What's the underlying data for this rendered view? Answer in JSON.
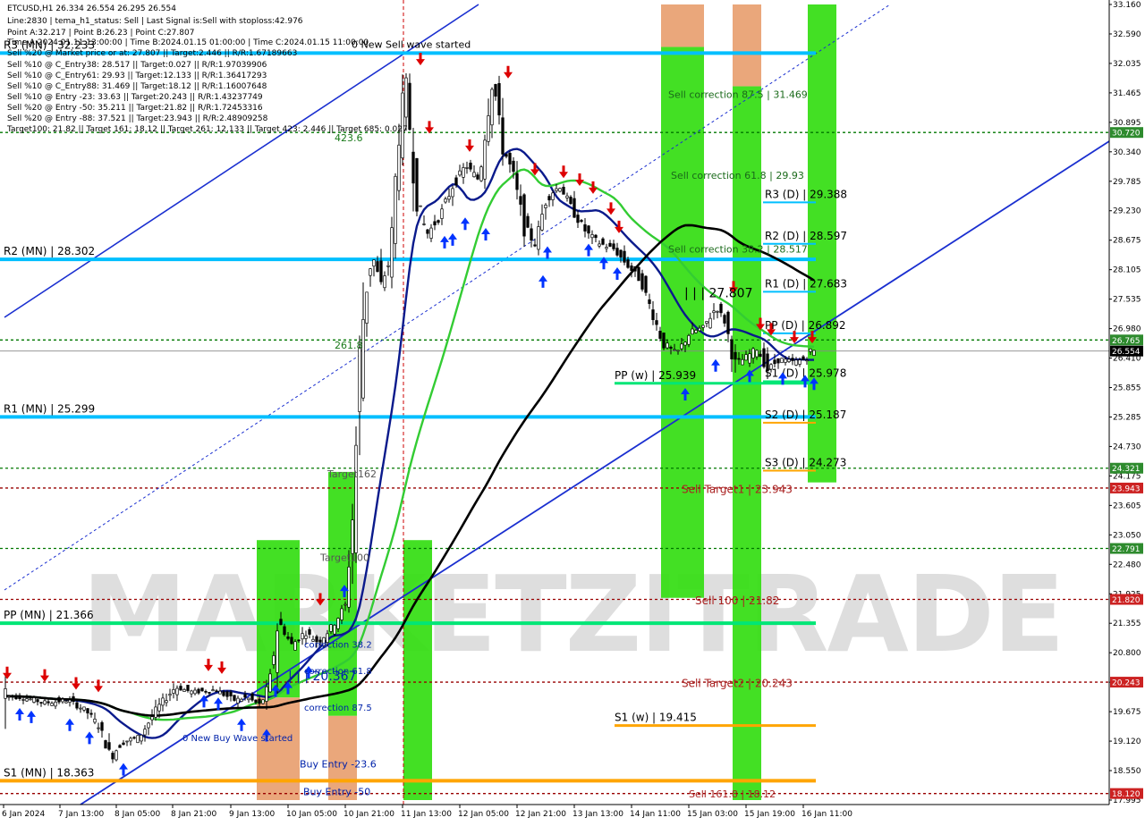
{
  "header": {
    "symbol_line": "ETCUSD,H1  26.334 26.554 26.295 26.554",
    "info_lines": [
      "Line:2830 | tema_h1_status: Sell | Last Signal is:Sell with stoploss:42.976",
      "Point A:32.217 | Point B:26.23 | Point C:27.807",
      "Time A:2024.01.11 13:00:00 | Time B:2024.01.15 01:00:00 | Time C:2024.01.15 11:00:00",
      "Sell %20 @ Market price or at: 27.807 || Target:2.446 || R/R:1.67189663",
      "Sell %10 @ C_Entry38: 28.517 || Target:0.027 || R/R:1.97039906",
      "Sell %10 @ C_Entry61: 29.93 || Target:12.133 || R/R:1.36417293",
      "Sell %10 @ C_Entry88: 31.469 || Target:18.12 || R/R:1.16007648",
      "Sell %10 @ Entry -23: 33.63 || Target:20.243 || R/R:1.43237749",
      "Sell %20 @ Entry -50: 35.211 || Target:21.82 || R/R:1.72453316",
      "Sell %20 @ Entry -88: 37.521 || Target:23.943 || R/R:2.48909258",
      "Target100: 21.82 || Target 161: 18.12 || Target 261: 12.133 || Target 423: 2.446 || Target 685: 0.027"
    ]
  },
  "watermark": "MARKETZITRADE",
  "colors": {
    "cyan_level": "#00bfff",
    "green_level": "#00e676",
    "orange_level": "#ffa500",
    "green_zone": "#33dd11",
    "salmon_zone": "#e8a070",
    "tema_blue": "#0a1a8c",
    "ma_green": "#33cc33",
    "ma_black": "#000000",
    "trend_blue": "#1a2fd0",
    "sell_red": "#dd0000",
    "buy_blue": "#0033ff",
    "dark_green_dotted": "#007700",
    "dark_red_dotted": "#990000"
  },
  "chart_data": {
    "type": "candlestick",
    "symbol": "ETCUSD",
    "timeframe": "H1",
    "ohlc_last": {
      "open": 26.334,
      "high": 26.554,
      "low": 26.295,
      "close": 26.554
    },
    "ylim": [
      17.995,
      33.16
    ],
    "y_ticks": [
      "33.160",
      "32.590",
      "32.035",
      "31.465",
      "30.895",
      "30.340",
      "29.785",
      "29.230",
      "28.675",
      "28.105",
      "27.535",
      "26.980",
      "26.410",
      "25.855",
      "25.285",
      "24.730",
      "24.175",
      "23.605",
      "23.050",
      "22.480",
      "21.925",
      "21.355",
      "20.800",
      "20.230",
      "19.675",
      "19.120",
      "18.550",
      "17.995"
    ],
    "x_ticks": [
      "6 Jan 2024",
      "7 Jan 13:00",
      "8 Jan 05:00",
      "8 Jan 21:00",
      "9 Jan 13:00",
      "10 Jan 05:00",
      "10 Jan 21:00",
      "11 Jan 13:00",
      "12 Jan 05:00",
      "12 Jan 21:00",
      "13 Jan 13:00",
      "14 Jan 11:00",
      "15 Jan 03:00",
      "15 Jan 19:00",
      "16 Jan 11:00"
    ],
    "price_tags": [
      {
        "value": 30.72,
        "label": "30.720",
        "kind": "green"
      },
      {
        "value": 26.765,
        "label": "26.765",
        "kind": "green"
      },
      {
        "value": 26.554,
        "label": "26.554",
        "kind": "black"
      },
      {
        "value": 24.321,
        "label": "24.321",
        "kind": "green"
      },
      {
        "value": 23.943,
        "label": "23.943",
        "kind": "red"
      },
      {
        "value": 22.791,
        "label": "22.791",
        "kind": "green"
      },
      {
        "value": 21.82,
        "label": "21.820",
        "kind": "red"
      },
      {
        "value": 20.243,
        "label": "20.243",
        "kind": "red"
      },
      {
        "value": 18.12,
        "label": "18.120",
        "kind": "red"
      }
    ],
    "monthly_levels": [
      {
        "name": "R3 (MN)",
        "label": "R3 (MN) | 32.233",
        "value": 32.233
      },
      {
        "name": "R2 (MN)",
        "label": "R2 (MN) | 28.302",
        "value": 28.302
      },
      {
        "name": "R1 (MN)",
        "label": "R1 (MN) | 25.299",
        "value": 25.299
      },
      {
        "name": "PP (MN)",
        "label": "PP (MN) | 21.366",
        "value": 21.366
      },
      {
        "name": "S1 (MN)",
        "label": "S1 (MN) | 18.363",
        "value": 18.363
      }
    ],
    "daily_levels": [
      {
        "label": "R3 (D) | 29.388",
        "value": 29.388
      },
      {
        "label": "R2 (D) | 28.597",
        "value": 28.597
      },
      {
        "label": "R1 (D) | 27.683",
        "value": 27.683
      },
      {
        "label": "PP (D) | 26.892",
        "value": 26.892
      },
      {
        "label": "S1 (D) | 25.978",
        "value": 25.978
      },
      {
        "label": "S2 (D) | 25.187",
        "value": 25.187
      },
      {
        "label": "S3 (D) | 24.273",
        "value": 24.273
      }
    ],
    "weekly_levels": [
      {
        "label": "PP (w) | 25.939",
        "value": 25.939
      },
      {
        "label": "S1 (w) | 19.415",
        "value": 19.415
      }
    ],
    "annotations": [
      {
        "text": "0 New Sell wave started",
        "value": 32.33
      },
      {
        "text": "423.6",
        "value": 30.55
      },
      {
        "text": "261.8",
        "value": 26.6
      },
      {
        "text": "Target162",
        "value": 24.15
      },
      {
        "text": "Target100",
        "value": 22.55
      },
      {
        "text": "correction 38.2",
        "value": 20.9
      },
      {
        "text": "correction 61.8",
        "value": 20.4
      },
      {
        "text": "| | | 20.367",
        "value": 20.28
      },
      {
        "text": "correction 87.5",
        "value": 19.7
      },
      {
        "text": "0 New Buy Wave started",
        "value": 19.12
      },
      {
        "text": "Buy Entry -23.6",
        "value": 18.62
      },
      {
        "text": "Buy Entry -50",
        "value": 18.09
      },
      {
        "text": "Sell correction 87.5 | 31.469",
        "value": 31.38
      },
      {
        "text": "Sell correction 61.8 | 29.93",
        "value": 29.84
      },
      {
        "text": "Sell correction 38.2 | 28.517",
        "value": 28.43
      },
      {
        "text": "| | | 27.807",
        "value": 27.58
      },
      {
        "text": "Sell Target1 | 23.943",
        "value": 23.85
      },
      {
        "text": "Sell 100 | 21.82",
        "value": 21.73
      },
      {
        "text": "Sell Target2 | 20.243",
        "value": 20.15
      },
      {
        "text": "Sell 161.8 | 18.12",
        "value": 18.05
      }
    ]
  }
}
